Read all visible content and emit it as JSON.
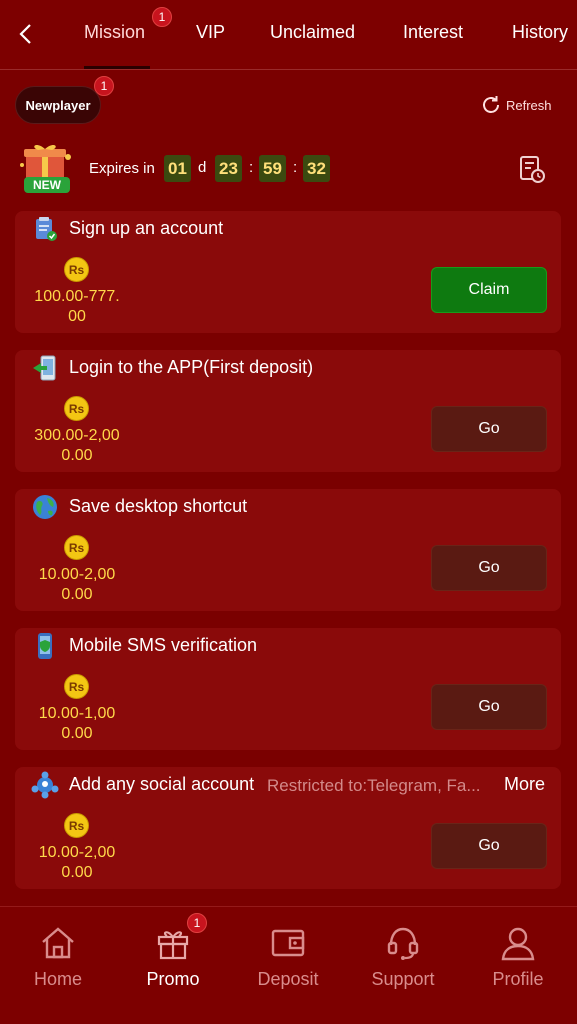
{
  "header": {
    "tabs": [
      {
        "label": "Mission",
        "badge": "1"
      },
      {
        "label": "VIP"
      },
      {
        "label": "Unclaimed"
      },
      {
        "label": "Interest"
      },
      {
        "label": "History"
      }
    ]
  },
  "filter": {
    "label": "Newplayer",
    "badge": "1",
    "refresh_label": "Refresh"
  },
  "timer": {
    "label": "Expires in",
    "days": "01",
    "days_unit": "d",
    "hours": "23",
    "minutes": "59",
    "seconds": "32",
    "new_label": "NEW"
  },
  "tasks": [
    {
      "title": "Sign up an account",
      "currency": "Rs",
      "reward_line1": "100.00-777.",
      "reward_line2": "00",
      "button": "Claim"
    },
    {
      "title": "Login to the APP(First deposit)",
      "currency": "Rs",
      "reward_line1": "300.00-2,00",
      "reward_line2": "0.00",
      "button": "Go"
    },
    {
      "title": "Save desktop shortcut",
      "currency": "Rs",
      "reward_line1": "10.00-2,00",
      "reward_line2": "0.00",
      "button": "Go"
    },
    {
      "title": "Mobile SMS verification",
      "currency": "Rs",
      "reward_line1": "10.00-1,00",
      "reward_line2": "0.00",
      "button": "Go"
    },
    {
      "title": "Add any social account",
      "restriction": "Restricted to:Telegram, Fa...",
      "more": "More",
      "currency": "Rs",
      "reward_line1": "10.00-2,00",
      "reward_line2": "0.00",
      "button": "Go"
    }
  ],
  "nav": {
    "items": [
      {
        "label": "Home",
        "icon": "home-icon"
      },
      {
        "label": "Promo",
        "icon": "gift-icon",
        "badge": "1",
        "active": true
      },
      {
        "label": "Deposit",
        "icon": "wallet-icon"
      },
      {
        "label": "Support",
        "icon": "headset-icon"
      },
      {
        "label": "Profile",
        "icon": "user-icon"
      }
    ]
  },
  "colors": {
    "background": "#7a0000",
    "card": "#8a0a0a",
    "claim": "#0e7a10",
    "go": "#5a1a12",
    "reward": "#ffd94a",
    "badge": "#c8141e"
  }
}
